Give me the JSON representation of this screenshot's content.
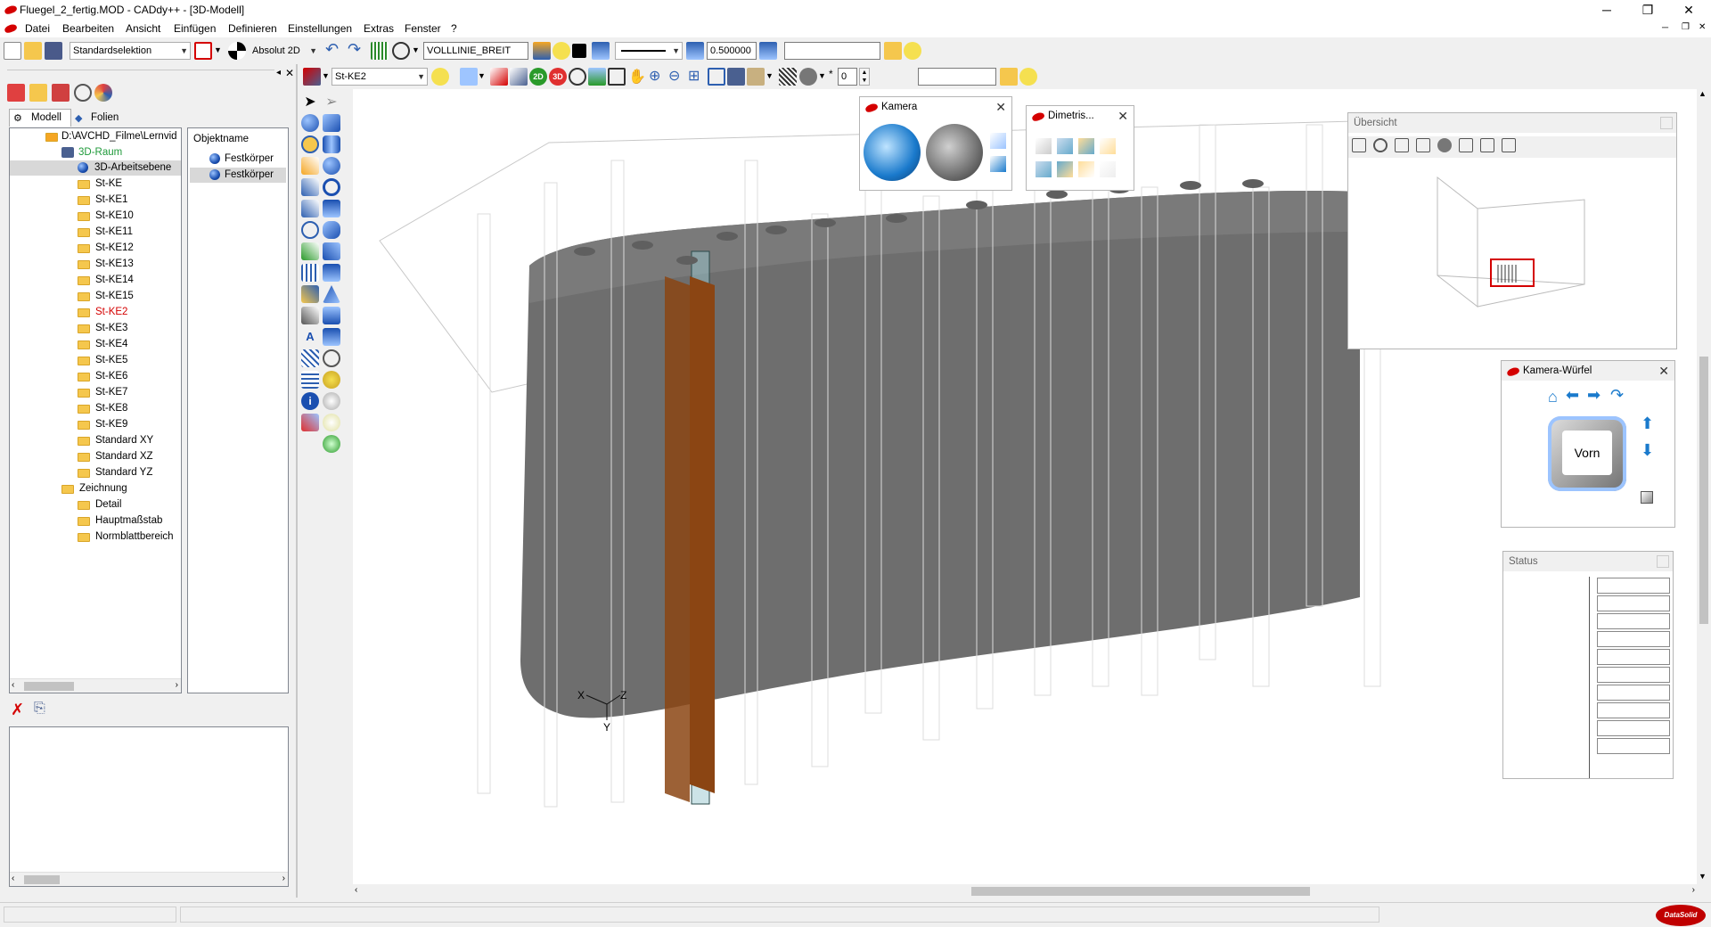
{
  "window": {
    "title": "Fluegel_2_fertig.MOD  -  CADdy++ - [3D-Modell]",
    "controls": {
      "minimize": "─",
      "restore": "❐",
      "close": "✕"
    }
  },
  "menu": {
    "items": [
      "Datei",
      "Bearbeiten",
      "Ansicht",
      "Einfügen",
      "Definieren",
      "Einstellungen",
      "Extras",
      "Fenster",
      "?"
    ]
  },
  "toolbar1": {
    "selection_mode": "Standardselektion",
    "coord_mode": "Absolut 2D",
    "linetype": "VOLLLINIE_BREIT",
    "line_width": "0.500000",
    "empty_field": ""
  },
  "toolbar2": {
    "layer": "St-KE2",
    "btn_2d": "2D",
    "btn_3d": "3D",
    "count_value": "0",
    "empty_field": ""
  },
  "tabs": {
    "modell": "Modell",
    "folien": "Folien"
  },
  "tree": {
    "root": "D:\\AVCHD_Filme\\Lernvid",
    "raum": "3D-Raum",
    "arbeitsebene": "3D-Arbeitsebene",
    "items": [
      "St-KE",
      "St-KE1",
      "St-KE10",
      "St-KE11",
      "St-KE12",
      "St-KE13",
      "St-KE14",
      "St-KE15",
      "St-KE2",
      "St-KE3",
      "St-KE4",
      "St-KE5",
      "St-KE6",
      "St-KE7",
      "St-KE8",
      "St-KE9",
      "Standard XY",
      "Standard XZ",
      "Standard YZ"
    ],
    "highlight": "St-KE2",
    "zeichnung": "Zeichnung",
    "zeichnung_items": [
      "Detail",
      "Hauptmaßstab",
      "Normblattbereich"
    ]
  },
  "objects": {
    "header": "Objektname",
    "items": [
      "Festkörper",
      "Festkörper"
    ]
  },
  "panels": {
    "kamera": "Kamera",
    "dimetrisch": "Dimetris...",
    "uebersicht": "Übersicht",
    "kamera_wuerfel": "Kamera-Würfel",
    "cube_face": "Vorn",
    "status": "Status"
  },
  "viewport": {
    "axis_x": "X",
    "axis_y": "Y",
    "axis_z": "Z"
  },
  "colors": {
    "solid": "#6e6e6e",
    "solid_top": "#7a7a7a",
    "orange_plate": "#8b4513",
    "selection_red": "#cc0000",
    "tree_green": "#1f9a3a",
    "tree_red": "#d40000"
  },
  "brand": "DataSolid"
}
